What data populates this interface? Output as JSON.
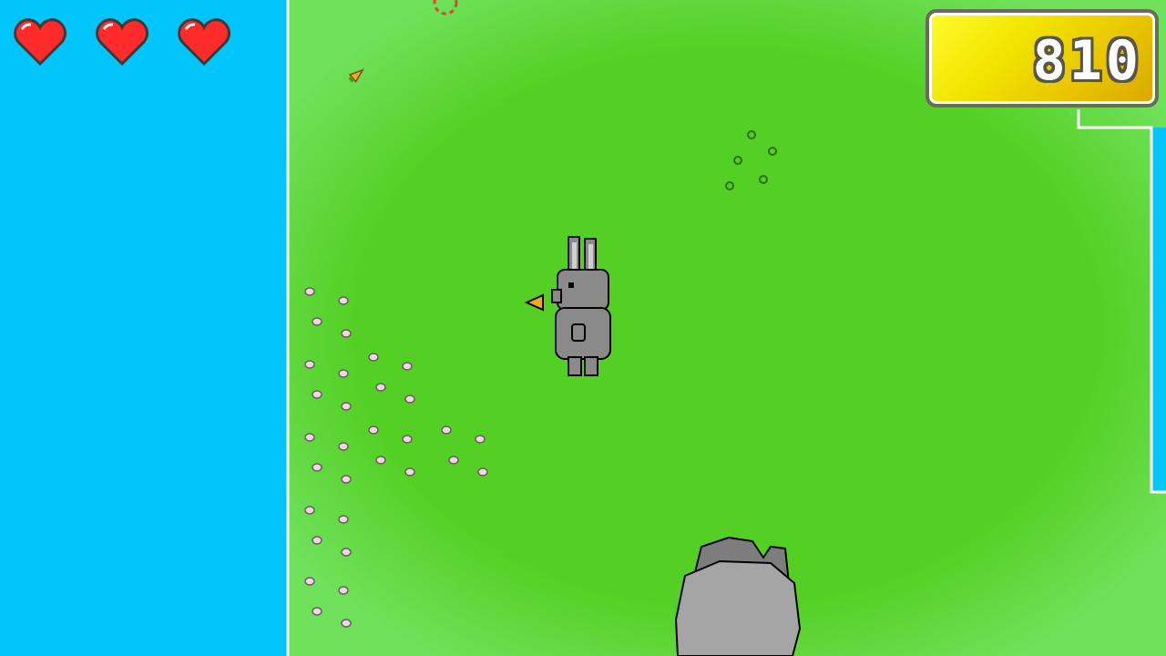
{
  "hud": {
    "lives": 3,
    "hearts": [
      "heart-icon",
      "heart-icon",
      "heart-icon"
    ],
    "score": "810"
  },
  "colors": {
    "water": "#02c6fb",
    "grass": "#53d023",
    "grass_edge": "#6fe15a",
    "heart": "#ff2a2a",
    "score_gold": "#f2e600",
    "rabbit_gray": "#8a8a8a",
    "rock_gray": "#a5a5a5",
    "carrot": "#f5a623"
  },
  "sprites": {
    "player": "gray-rabbit",
    "item": "carrot-icon",
    "enemy": "rock-rabbit"
  }
}
